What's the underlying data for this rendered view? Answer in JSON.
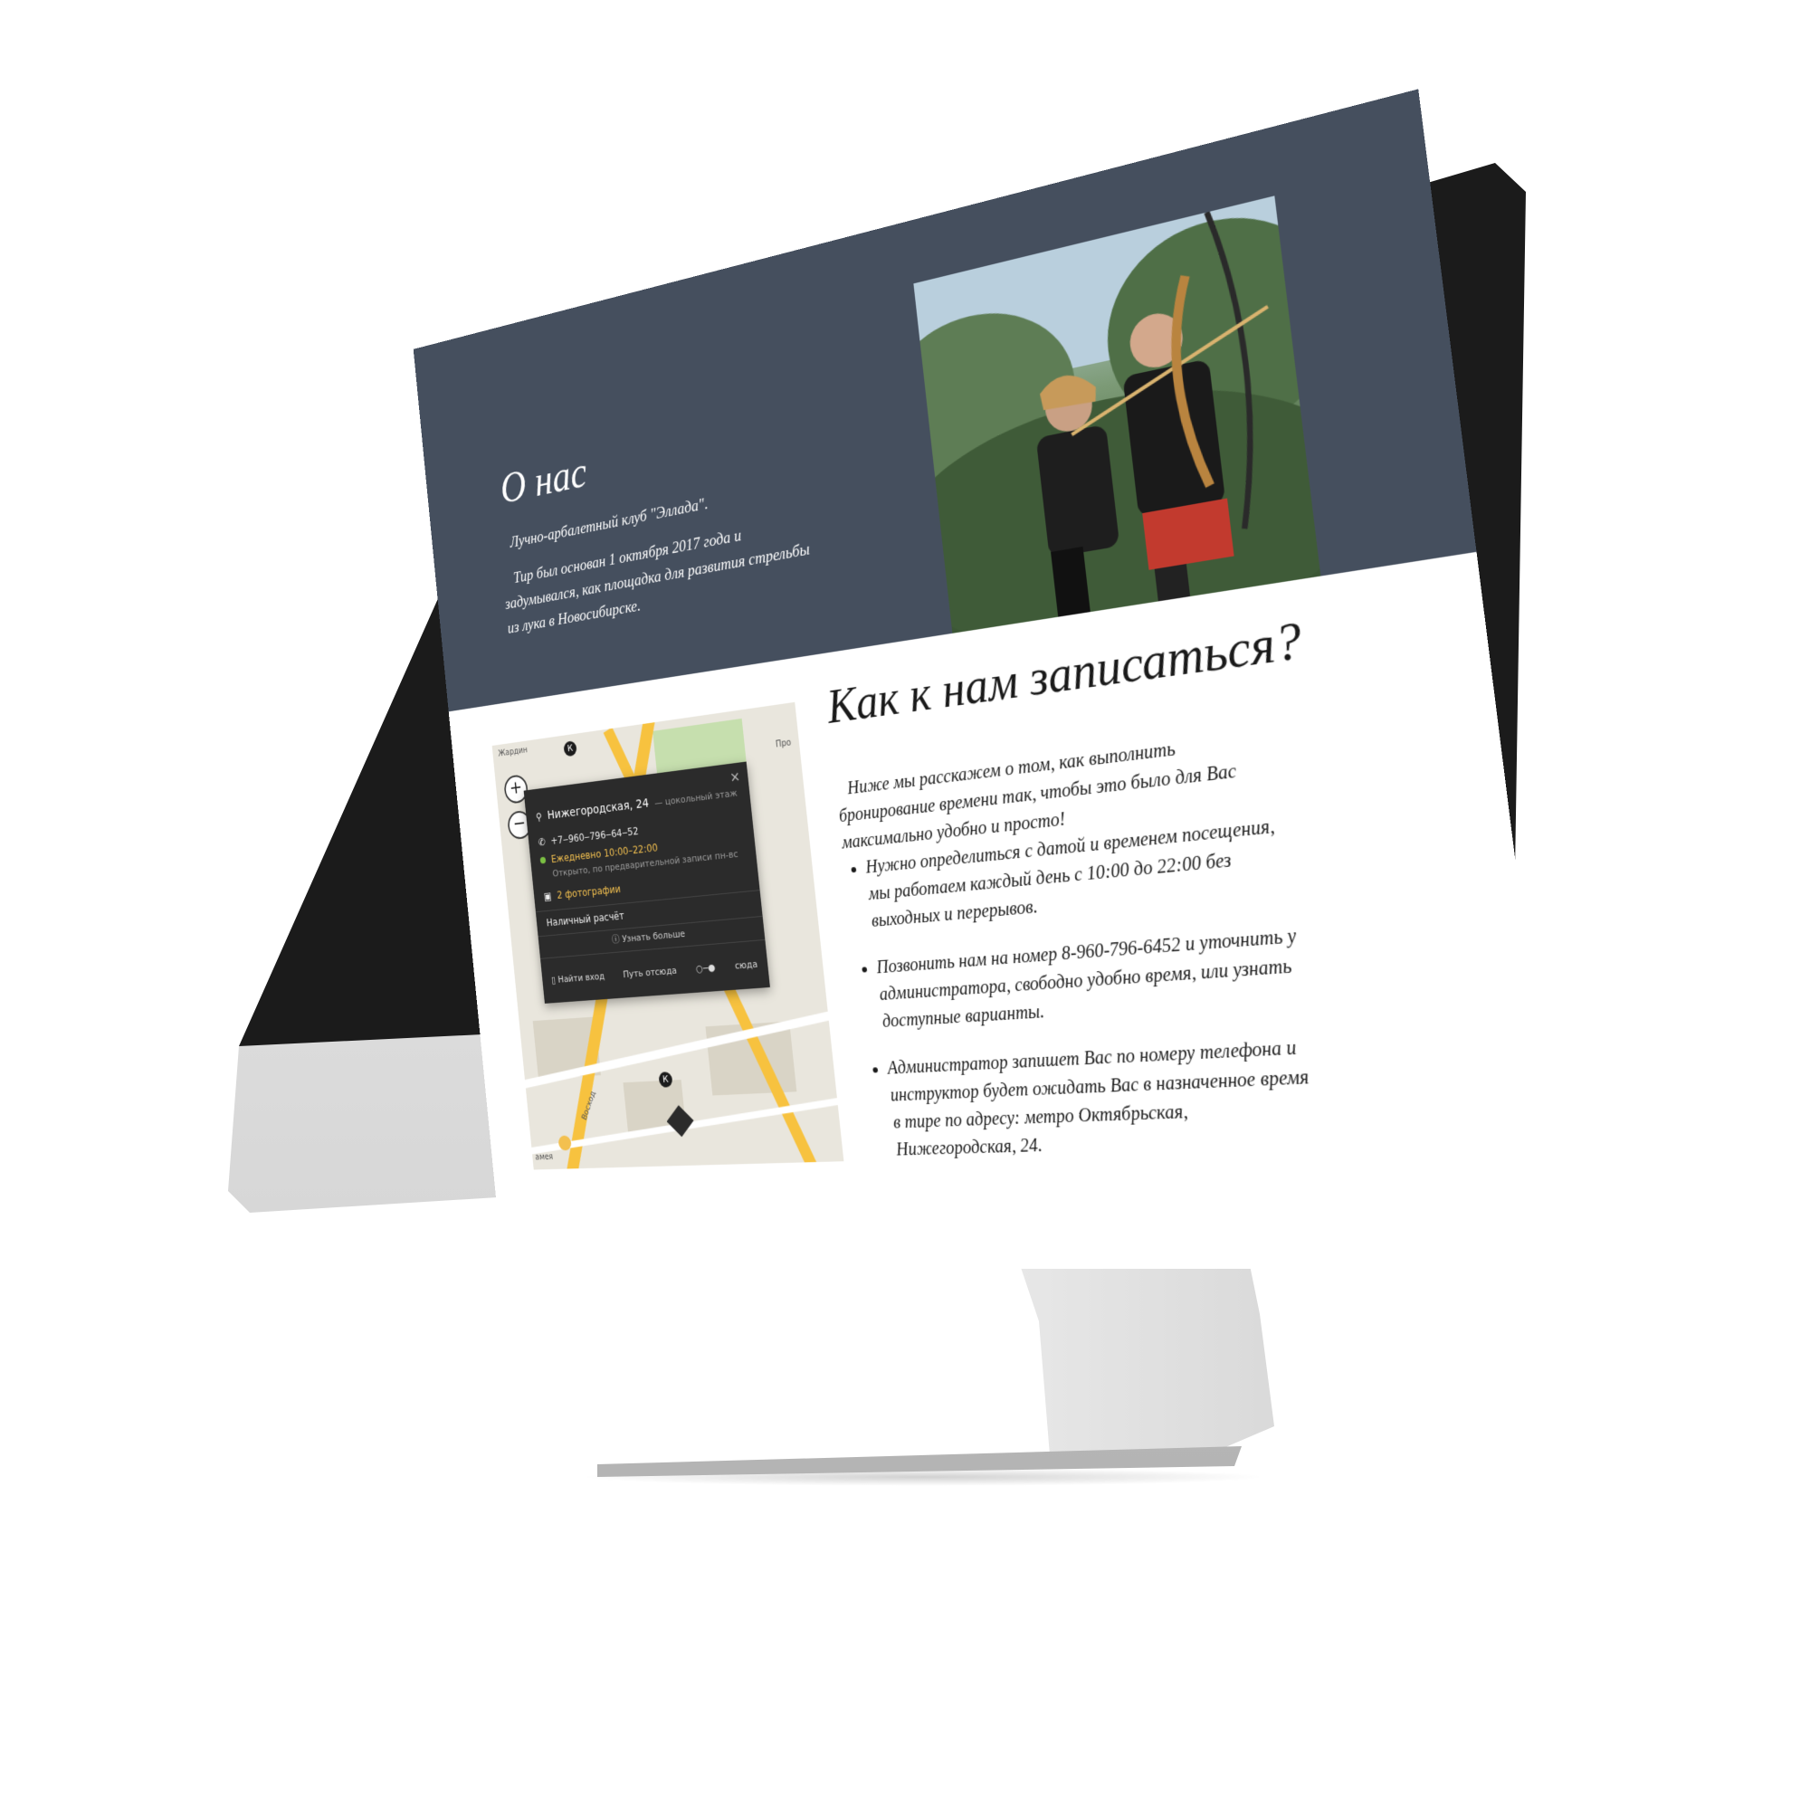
{
  "about": {
    "title": "О нас",
    "paragraphs": [
      "Лучно-арбалетный клуб \"Эллада\".",
      "Тир был основан 1 октября 2017 года и задумывался, как площадка для развития стрельбы из лука в Новосибирске."
    ]
  },
  "booking": {
    "title": "Как к нам записаться?",
    "intro": "Ниже мы расскажем о том, как выполнить бронирование времени так, чтобы это было для Вас максимально удобно и просто!",
    "items": [
      "Нужно определиться с датой и временем посещения, мы работаем каждый день с 10:00 до 22:00 без выходных и перерывов.",
      "Позвонить нам на номер 8-960-796-6452 и уточнить у администратора, свободно удобно время, или узнать доступные варианты.",
      "Администратор запишет Вас по номеру телефона и инструктор будет ожидать Вас в назначенное время в тире по адресу: метро Октябрьская, Нижегородская, 24."
    ]
  },
  "map": {
    "zoom_in": "+",
    "zoom_out": "−",
    "labels": {
      "street_top": "Жардин",
      "street_right": "Про",
      "street_left": "амея",
      "street_diag": "Восход"
    },
    "popup": {
      "close": "×",
      "address": "Нижегородская, 24",
      "address_note": "— цокольный этаж",
      "phone": "+7‒960‒796‒64‒52",
      "hours": "Ежедневно 10:00–22:00",
      "hours_note": "Открыто, по предварительной записи пн-вс",
      "photos": "2 фотографии",
      "payment": "Наличный расчёт",
      "more": "Узнать больше",
      "find_entrance": "Найти вход",
      "route_from": "Путь отсюда",
      "route_to": "сюда"
    },
    "pin_letter": "К",
    "colors": {
      "road": "#f7c23f",
      "popup_bg": "#2b2b2b",
      "accent": "#f3c04f"
    }
  },
  "colors": {
    "about_bg": "#454f5e",
    "bezel": "#1b1b1b"
  }
}
